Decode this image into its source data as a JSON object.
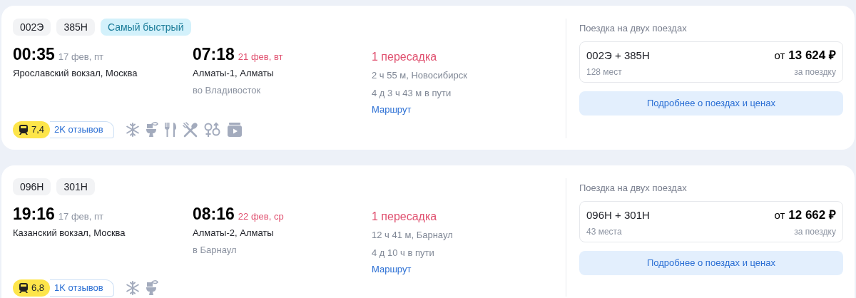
{
  "trips": [
    {
      "tags": [
        {
          "kind": "train",
          "text": "002Э"
        },
        {
          "kind": "train",
          "text": "385Н"
        },
        {
          "kind": "badge",
          "text": "Самый быстрый"
        }
      ],
      "departure": {
        "time": "00:35",
        "date": "17 фев, пт",
        "date_highlight": false,
        "station": "Ярославский вокзал, Москва"
      },
      "arrival": {
        "time": "07:18",
        "date": "21 фев, вт",
        "date_highlight": true,
        "station": "Алматы-1, Алматы",
        "note": "во Владивосток"
      },
      "transfers": "1 пересадка",
      "transfer_detail": "2 ч 55 м, Новосибирск",
      "duration": "4 д 3 ч 43 м в пути",
      "route_link": "Маршрут",
      "rating": "7,4",
      "reviews": "2K отзывов",
      "amenities": [
        {
          "kind": "ac"
        },
        {
          "kind": "toilet"
        },
        {
          "kind": "dining"
        },
        {
          "kind": "food"
        },
        {
          "kind": "gender"
        },
        {
          "kind": "video"
        }
      ],
      "offer": {
        "title": "Поездка на двух поездах",
        "trains": "002Э + 385Н",
        "seats": "128 мест",
        "price_prefix": "от",
        "price": "13 624 ₽",
        "price_note": "за поездку",
        "button": "Подробнее о поездах и ценах"
      }
    },
    {
      "tags": [
        {
          "kind": "train",
          "text": "096Н"
        },
        {
          "kind": "train",
          "text": "301Н"
        }
      ],
      "departure": {
        "time": "19:16",
        "date": "17 фев, пт",
        "date_highlight": false,
        "station": "Казанский вокзал, Москва"
      },
      "arrival": {
        "time": "08:16",
        "date": "22 фев, ср",
        "date_highlight": true,
        "station": "Алматы-2, Алматы",
        "note": "в Барнаул"
      },
      "transfers": "1 пересадка",
      "transfer_detail": "12 ч 41 м, Барнаул",
      "duration": "4 д 10 ч в пути",
      "route_link": "Маршрут",
      "rating": "6,8",
      "reviews": "1K отзывов",
      "amenities": [
        {
          "kind": "ac"
        },
        {
          "kind": "toilet"
        }
      ],
      "offer": {
        "title": "Поездка на двух поездах",
        "trains": "096Н + 301Н",
        "seats": "43 места",
        "price_prefix": "от",
        "price": "12 662 ₽",
        "price_note": "за поездку",
        "button": "Подробнее о поездах и ценах"
      }
    }
  ]
}
